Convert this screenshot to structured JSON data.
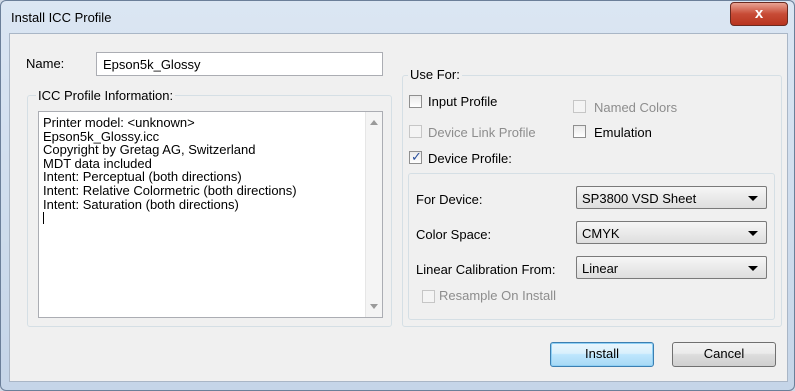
{
  "window": {
    "title": "Install ICC Profile",
    "close_glyph": "x"
  },
  "name_field": {
    "label": "Name:",
    "value": "Epson5k_Glossy"
  },
  "icc_info": {
    "legend": "ICC Profile Information:",
    "lines": [
      "Printer model: <unknown>",
      "Epson5k_Glossy.icc",
      "Copyright by Gretag AG, Switzerland",
      "MDT data included",
      "Intent: Perceptual (both directions)",
      "Intent: Relative Colormetric (both directions)",
      "Intent: Saturation (both directions)"
    ]
  },
  "use_for": {
    "legend": "Use For:",
    "input_profile": {
      "label": "Input Profile",
      "checked": false,
      "enabled": true
    },
    "named_colors": {
      "label": "Named Colors",
      "checked": false,
      "enabled": false
    },
    "device_link_profile": {
      "label": "Device Link Profile",
      "checked": false,
      "enabled": false
    },
    "emulation": {
      "label": "Emulation",
      "checked": false,
      "enabled": true
    },
    "device_profile": {
      "label": "Device Profile:",
      "checked": true,
      "enabled": true
    }
  },
  "device": {
    "for_device_label": "For Device:",
    "for_device_value": "SP3800 VSD Sheet",
    "color_space_label": "Color Space:",
    "color_space_value": "CMYK",
    "linear_cal_label": "Linear Calibration From:",
    "linear_cal_value": "Linear",
    "resample_label": "Resample On Install"
  },
  "buttons": {
    "install": "Install",
    "cancel": "Cancel"
  }
}
